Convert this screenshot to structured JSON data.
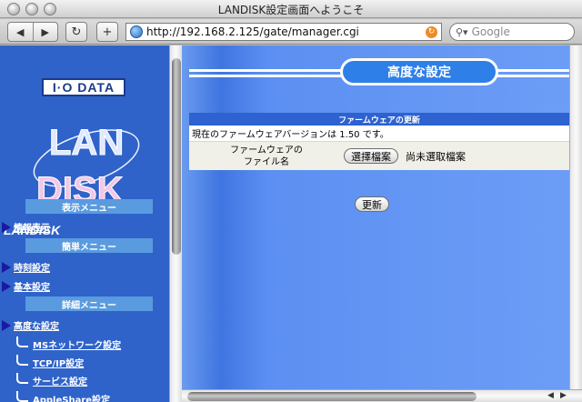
{
  "window": {
    "title": "LANDISK設定画面へようこそ"
  },
  "toolbar": {
    "back_glyph": "◀",
    "forward_glyph": "▶",
    "reload_glyph": "↻",
    "add_glyph": "+",
    "url": "http://192.168.2.125/gate/manager.cgi",
    "search_placeholder": "Google"
  },
  "sidebar": {
    "logo_brand": "I·O DATA",
    "logo_product_line1": "LAN",
    "logo_product_line2": "DISK",
    "brand_label": "LANDISK",
    "sections": {
      "display": "表示メニュー",
      "simple": "簡単メニュー",
      "detail": "詳細メニュー"
    },
    "items": {
      "info": "情報表示",
      "clock": "時刻設定",
      "basic": "基本設定",
      "advanced": "高度な設定"
    },
    "sub_items": {
      "ms_network": "MSネットワーク設定",
      "tcpip": "TCP/IP設定",
      "service": "サービス設定",
      "appleshare": "AppleShare設定"
    }
  },
  "main": {
    "page_title": "高度な設定",
    "firmware": {
      "section_title": "ファームウェアの更新",
      "current_version_text": "現在のファームウェアバージョンは 1.50 です。",
      "file_label_line1": "ファームウェアの",
      "file_label_line2": "ファイル名",
      "choose_file_button": "選擇檔案",
      "no_file_text": "尚未選取檔案"
    },
    "update_button": "更新"
  },
  "colors": {
    "sidebar_bg": "#2f63c9",
    "menu_header_bg": "#5a9be0",
    "main_bg": "#6c9df6",
    "pill_bg": "#2e7fe8"
  }
}
